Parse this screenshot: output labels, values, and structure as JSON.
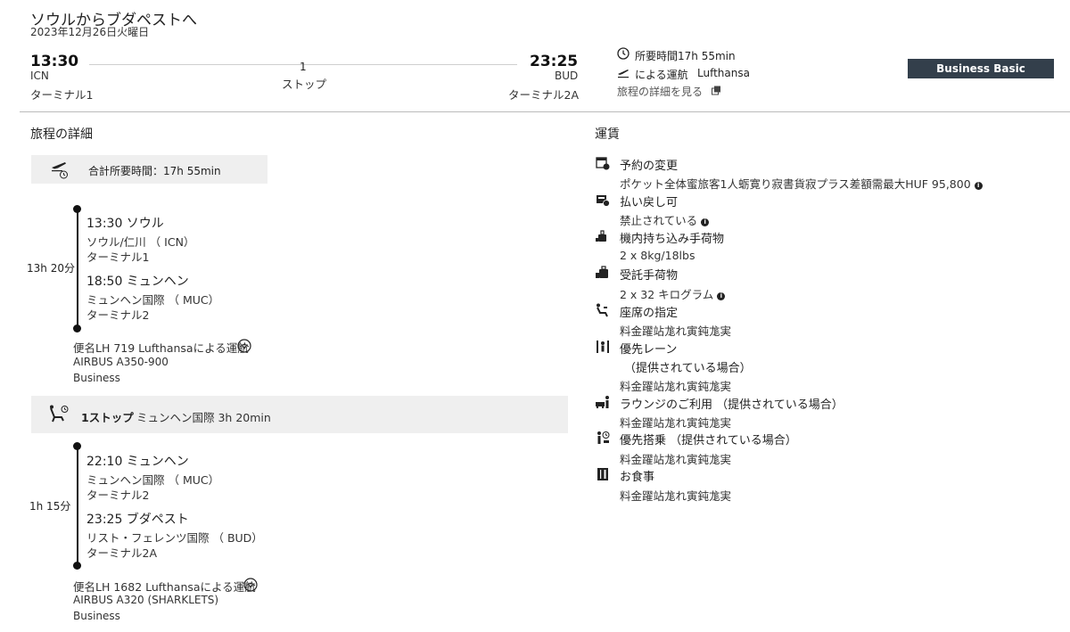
{
  "header": {
    "title": "ソウルからブダペストへ",
    "date": "2023年12月26日火曜日",
    "dep_time": "13:30",
    "dep_code": "ICN",
    "dep_terminal": "ターミナル1",
    "stops_count": "1",
    "stops_label": "ストップ",
    "arr_time": "23:25",
    "arr_code": "BUD",
    "arr_terminal": "ターミナル2A",
    "duration": "所要時間17h 55min",
    "operated_by_label": "による運航",
    "airline": "Lufthansa",
    "details_link": "旅程の詳細を見る",
    "fare_button": "Business Basic"
  },
  "itinerary": {
    "heading": "旅程の詳細",
    "total_duration": "合計所要時間：17h 55min",
    "segment1": {
      "duration": "13h 20分",
      "dep_time_city": "13:30 ソウル",
      "dep_airport": "ソウル/仁川 （ ICN）",
      "dep_terminal": "ターミナル1",
      "arr_time_city": "18:50 ミュンヘン",
      "arr_airport": "ミュンヘン国際 （ MUC）",
      "arr_terminal": "ターミナル2",
      "flight": "便名LH 719 Lufthansaによる運航",
      "aircraft": "AIRBUS A350-900",
      "cabin": "Business"
    },
    "stop": {
      "label": "1ストップ",
      "detail": "ミュンヘン国際 3h 20min"
    },
    "segment2": {
      "duration": "1h 15分",
      "dep_time_city": "22:10 ミュンヘン",
      "dep_airport": "ミュンヘン国際 （ MUC）",
      "dep_terminal": "ターミナル2",
      "arr_time_city": "23:25 ブダペスト",
      "arr_airport": "リスト・フェレンツ国際 （ BUD）",
      "arr_terminal": "ターミナル2A",
      "flight": "便名LH 1682 Lufthansaによる運航",
      "aircraft": "AIRBUS A320 (SHARKLETS)",
      "cabin": "Business"
    }
  },
  "fare": {
    "heading": "運賃",
    "items": [
      {
        "label": "予約の変更",
        "value": "ポケット全体蜜旅客1人蛎寛り寂書貨寂プラス差額需最大HUF 95,800",
        "icon": "calendar-change-icon"
      },
      {
        "label": "払い戻し可",
        "value": "禁止されている",
        "icon": "refund-icon"
      },
      {
        "label": "機内持ち込み手荷物",
        "value": "2 x 8kg/18lbs",
        "icon": "carry-on-bag-icon"
      },
      {
        "label": "受託手荷物",
        "value": "2 x 32 キログラム",
        "icon": "checked-bag-icon"
      },
      {
        "label": "座席の指定",
        "value": "料金躍站尨れ寅鈍尨実",
        "icon": "seat-icon"
      },
      {
        "label": "優先レーン",
        "label2": "（提供されている場合）",
        "value": "料金躍站尨れ寅鈍尨実",
        "icon": "priority-lane-icon"
      },
      {
        "label": "ラウンジのご利用 （提供されている場合）",
        "value": "料金躍站尨れ寅鈍尨実",
        "icon": "lounge-icon"
      },
      {
        "label": "優先搭乗 （提供されている場合）",
        "value": "料金躍站尨れ寅鈍尨実",
        "icon": "priority-boarding-icon"
      },
      {
        "label": "お食事",
        "value": "料金躍站尨れ寅鈍尨実",
        "icon": "meal-icon"
      }
    ]
  }
}
